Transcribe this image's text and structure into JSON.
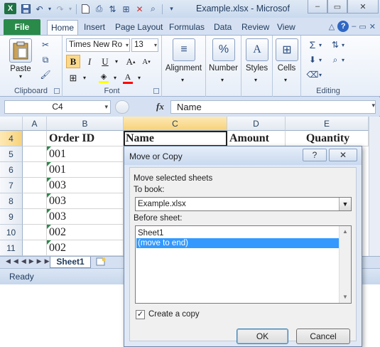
{
  "window": {
    "title": "Example.xlsx - Microsof",
    "app_icon": "X"
  },
  "qat": {
    "icons": [
      "save-icon",
      "undo-icon",
      "redo-icon",
      "new-icon",
      "print-preview-icon",
      "sort-icon",
      "filter-icon",
      "clear-icon",
      "find-icon"
    ]
  },
  "tabs": {
    "file": "File",
    "items": [
      "Home",
      "Insert",
      "Page Layout",
      "Formulas",
      "Data",
      "Review",
      "View"
    ]
  },
  "ribbon": {
    "clipboard": {
      "label": "Clipboard",
      "paste": "Paste"
    },
    "font": {
      "label": "Font",
      "name": "Times New Ro",
      "size": "13"
    },
    "alignment": {
      "label": "Alignment"
    },
    "number": {
      "label": "Number"
    },
    "styles": {
      "label": "Styles"
    },
    "cells": {
      "label": "Cells"
    },
    "editing": {
      "label": "Editing"
    },
    "colors": {
      "highlight": "#ffff00",
      "font_color": "#ff0000"
    }
  },
  "formula_bar": {
    "name_box": "C4",
    "fx": "fx",
    "content": "Name"
  },
  "sheet": {
    "columns": [
      "A",
      "B",
      "C",
      "D",
      "E"
    ],
    "rows": [
      {
        "num": "4",
        "b": "Order ID",
        "c": "Name",
        "d": "Amount",
        "e": "Quantity"
      },
      {
        "num": "5",
        "b": "001",
        "c": "",
        "d": "",
        "e": ""
      },
      {
        "num": "6",
        "b": "001",
        "c": "",
        "d": "",
        "e": ""
      },
      {
        "num": "7",
        "b": "003",
        "c": "",
        "d": "",
        "e": ""
      },
      {
        "num": "8",
        "b": "003",
        "c": "",
        "d": "",
        "e": ""
      },
      {
        "num": "9",
        "b": "003",
        "c": "",
        "d": "",
        "e": ""
      },
      {
        "num": "10",
        "b": "002",
        "c": "",
        "d": "",
        "e": ""
      },
      {
        "num": "11",
        "b": "002",
        "c": "",
        "d": "",
        "e": ""
      }
    ],
    "tab": "Sheet1"
  },
  "status": {
    "text": "Ready"
  },
  "dialog": {
    "title": "Move or Copy",
    "help": "?",
    "close": "✕",
    "intro": "Move selected sheets",
    "to_book_label": "To book:",
    "to_book_value": "Example.xlsx",
    "before_sheet_label": "Before sheet:",
    "before_sheet_items": [
      "Sheet1",
      "(move to end)"
    ],
    "selected_index": 1,
    "create_copy_label": "Create a copy",
    "create_copy_checked": true,
    "ok": "OK",
    "cancel": "Cancel"
  }
}
